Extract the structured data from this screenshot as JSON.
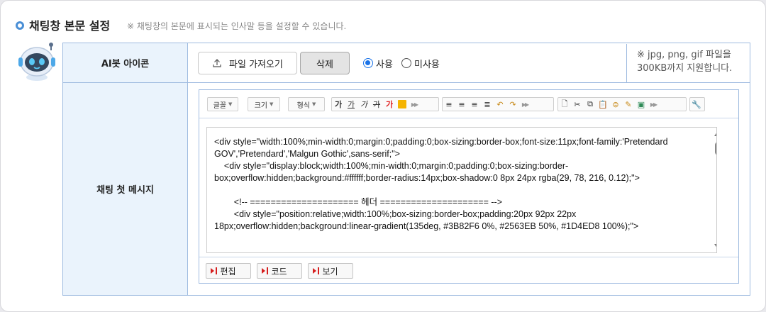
{
  "section": {
    "title": "채팅창 본문 설정",
    "subtitle": "※ 채팅창의 본문에 표시되는 인사말 등을 설정할 수 있습니다."
  },
  "icon_row": {
    "header": "AI봇 아이콘",
    "upload_label": "파일 가져오기",
    "delete_label": "삭제",
    "radio_use": "사용",
    "radio_unused": "미사용",
    "selected": "사용",
    "note": "※ jpg, png, gif 파일을 300KB까지 지원합니다."
  },
  "message_row": {
    "header": "채팅 첫 메시지"
  },
  "toolbar": {
    "font": "글꼴",
    "size": "크기",
    "format": "형식",
    "bold": "가",
    "underline": "가",
    "italic": "가",
    "strike": "가",
    "color": "가"
  },
  "code": {
    "lines": [
      "<div style=\"width:100%;min-width:0;margin:0;padding:0;box-sizing:border-box;font-size:11px;font-family:'Pretendard GOV','Pretendard','Malgun Gothic',sans-serif;\">",
      "    <div style=\"display:block;width:100%;min-width:0;margin:0;padding:0;box-sizing:border-box;overflow:hidden;background:#ffffff;border-radius:14px;box-shadow:0 8px 24px rgba(29, 78, 216, 0.12);\">",
      "",
      "        <!-- ===================== 헤더 ===================== -->",
      "        <div style=\"position:relative;width:100%;box-sizing:border-box;padding:20px 92px 22px 18px;overflow:hidden;background:linear-gradient(135deg, #3B82F6 0%, #2563EB 50%, #1D4ED8 100%);\">"
    ]
  },
  "modes": {
    "edit": "편집",
    "code": "코드",
    "preview": "보기"
  }
}
